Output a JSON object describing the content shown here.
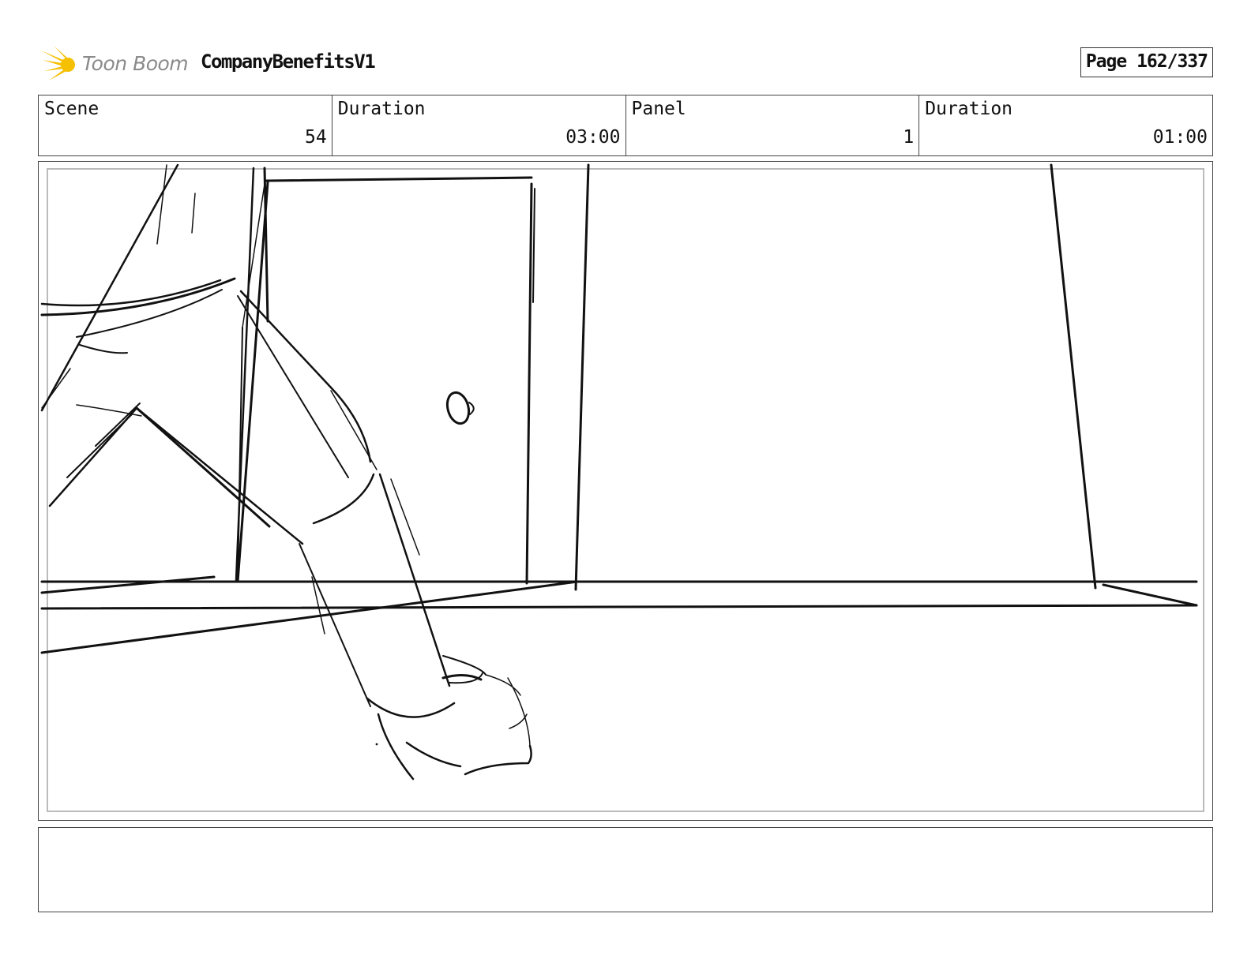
{
  "header": {
    "logo_text": "Toon Boom",
    "project_title": "CompanyBenefitsV1",
    "page_label": "Page 162/337"
  },
  "info": {
    "scene_label": "Scene",
    "scene_value": "54",
    "scene_duration_label": "Duration",
    "scene_duration_value": "03:00",
    "panel_label": "Panel",
    "panel_value": "1",
    "panel_duration_label": "Duration",
    "panel_duration_value": "01:00"
  },
  "colors": {
    "logo_yellow": "#f5c000",
    "logo_text": "#8a8a8a",
    "border": "#444444",
    "inner_frame": "#bbbbbb",
    "sketch_ink": "#111111"
  },
  "notes": {
    "text": ""
  }
}
